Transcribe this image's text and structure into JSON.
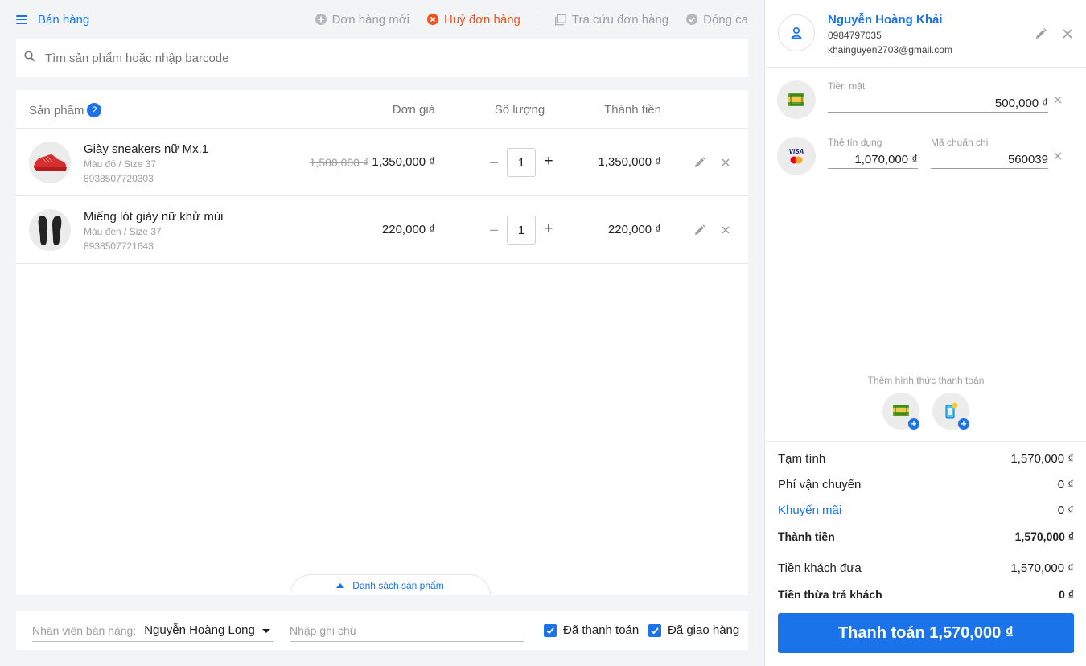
{
  "header": {
    "title": "Bán hàng",
    "actions": {
      "new_order": "Đơn hàng mới",
      "cancel_order": "Huỷ đơn hàng",
      "lookup_order": "Tra cứu đơn hàng",
      "close_shift": "Đóng ca"
    },
    "colors": {
      "accent": "#1a73e8",
      "danger": "#f4511e",
      "muted": "#9aa0a6"
    }
  },
  "search": {
    "placeholder": "Tìm sản phẩm hoặc nhập barcode",
    "value": ""
  },
  "products": {
    "columns": {
      "product": "Sản phẩm",
      "unit_price": "Đơn giá",
      "quantity": "Số lượng",
      "total": "Thành tiền"
    },
    "count": "2",
    "items": [
      {
        "name": "Giày sneakers nữ Mx.1",
        "variant": "Màu đỏ / Size 37",
        "barcode": "8938507720303",
        "old_price": "1,500,000 ₫",
        "price": "1,350,000 ₫",
        "quantity": "1",
        "total": "1,350,000 ₫",
        "image_icon": "red-sneaker-image"
      },
      {
        "name": "Miếng lót giày nữ khử mùi",
        "variant": "Màu đen / Size 37",
        "barcode": "8938507721643",
        "old_price": "",
        "price": "220,000 ₫",
        "quantity": "1",
        "total": "220,000 ₫",
        "image_icon": "black-insoles-image"
      }
    ],
    "list_toggle": "Danh sách sản phẩm"
  },
  "footer": {
    "staff_label": "Nhân viên bán hàng:",
    "staff_value": "Nguyễn Hoàng Long",
    "note_placeholder": "Nhập ghi chú",
    "paid_label": "Đã thanh toán",
    "delivered_label": "Đã giao hàng",
    "paid_checked": true,
    "delivered_checked": true
  },
  "customer": {
    "name": "Nguyễn Hoàng Khải",
    "phone": "0984797035",
    "email": "khainguyen2703@gmail.com"
  },
  "payments": {
    "cash": {
      "label": "Tiền mặt",
      "value": "500,000 ₫",
      "icon": "cash-icon"
    },
    "card": {
      "label": "Thẻ tín dụng",
      "value": "1,070,000 ₫",
      "auth_label": "Mã chuẩn chi",
      "auth_value": "560039",
      "icon": "visa-mastercard-icon"
    },
    "add_label": "Thêm hình thức thanh toán"
  },
  "summary": {
    "subtotal_label": "Tạm tính",
    "subtotal": "1,570,000 ₫",
    "shipping_label": "Phí vận chuyển",
    "shipping": "0 ₫",
    "promo_label": "Khuyến mãi",
    "promo": "0 ₫",
    "total_label": "Thành tiền",
    "total": "1,570,000 ₫",
    "given_label": "Tiền khách đưa",
    "given": "1,570,000 ₫",
    "change_label": "Tiền thừa trả khách",
    "change": "0 ₫"
  },
  "checkout_button": "Thanh toán 1,570,000 ₫"
}
